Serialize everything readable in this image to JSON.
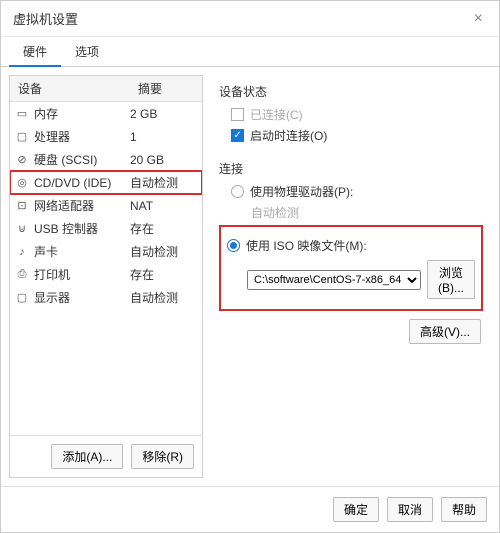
{
  "window": {
    "title": "虚拟机设置"
  },
  "tabs": {
    "hardware": "硬件",
    "options": "选项"
  },
  "columns": {
    "device": "设备",
    "summary": "摘要"
  },
  "devices": [
    {
      "icon": "▭",
      "name": "内存",
      "summary": "2 GB"
    },
    {
      "icon": "▢",
      "name": "处理器",
      "summary": "1"
    },
    {
      "icon": "⊘",
      "name": "硬盘 (SCSI)",
      "summary": "20 GB"
    },
    {
      "icon": "◎",
      "name": "CD/DVD (IDE)",
      "summary": "自动检测"
    },
    {
      "icon": "⊡",
      "name": "网络适配器",
      "summary": "NAT"
    },
    {
      "icon": "⊍",
      "name": "USB 控制器",
      "summary": "存在"
    },
    {
      "icon": "♪",
      "name": "声卡",
      "summary": "自动检测"
    },
    {
      "icon": "⎙",
      "name": "打印机",
      "summary": "存在"
    },
    {
      "icon": "▢",
      "name": "显示器",
      "summary": "自动检测"
    }
  ],
  "left_buttons": {
    "add": "添加(A)...",
    "remove": "移除(R)"
  },
  "right": {
    "status_label": "设备状态",
    "connected": "已连接(C)",
    "connect_at_power_on": "启动时连接(O)",
    "connection_label": "连接",
    "use_physical": "使用物理驱动器(P):",
    "physical_value": "自动检测",
    "use_iso": "使用 ISO 映像文件(M):",
    "iso_path": "C:\\software\\CentOS-7-x86_64",
    "browse": "浏览(B)...",
    "advanced": "高级(V)..."
  },
  "footer": {
    "ok": "确定",
    "cancel": "取消",
    "help": "帮助"
  }
}
